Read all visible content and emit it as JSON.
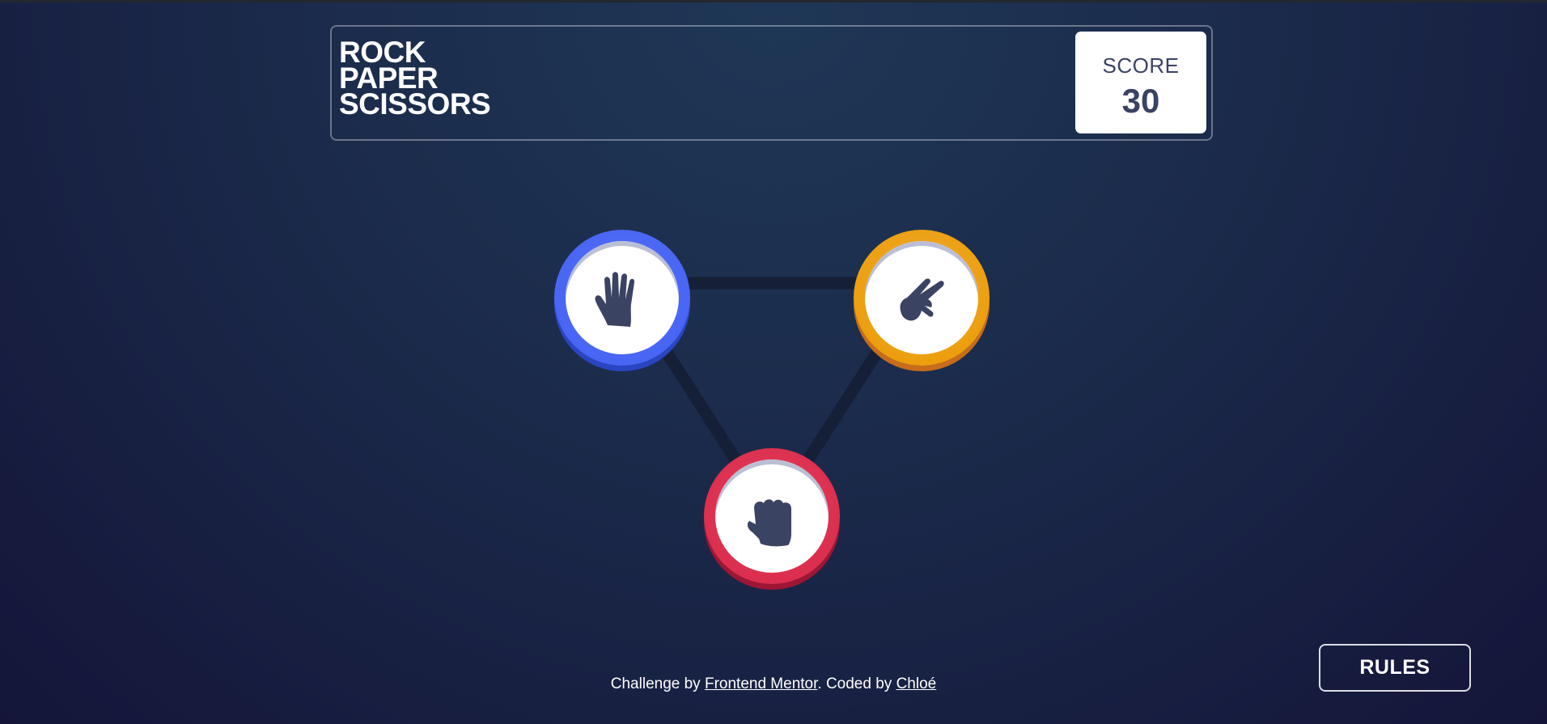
{
  "header": {
    "title_lines": [
      "ROCK",
      "PAPER",
      "SCISSORS"
    ],
    "score_label": "SCORE",
    "score_value": "30"
  },
  "game": {
    "choices": [
      {
        "id": "paper",
        "icon": "paper-hand-icon",
        "color": "#4865f4"
      },
      {
        "id": "scissors",
        "icon": "scissors-hand-icon",
        "color": "#ec9e0e"
      },
      {
        "id": "rock",
        "icon": "rock-fist-icon",
        "color": "#dc2e4e"
      }
    ],
    "triangle_color": "#141d34"
  },
  "footer": {
    "challenge_prefix": "Challenge by ",
    "challenge_link": "Frontend Mentor",
    "coded_prefix": ". Coded by ",
    "author_link": "Chloé"
  },
  "rules_button": "RULES"
}
